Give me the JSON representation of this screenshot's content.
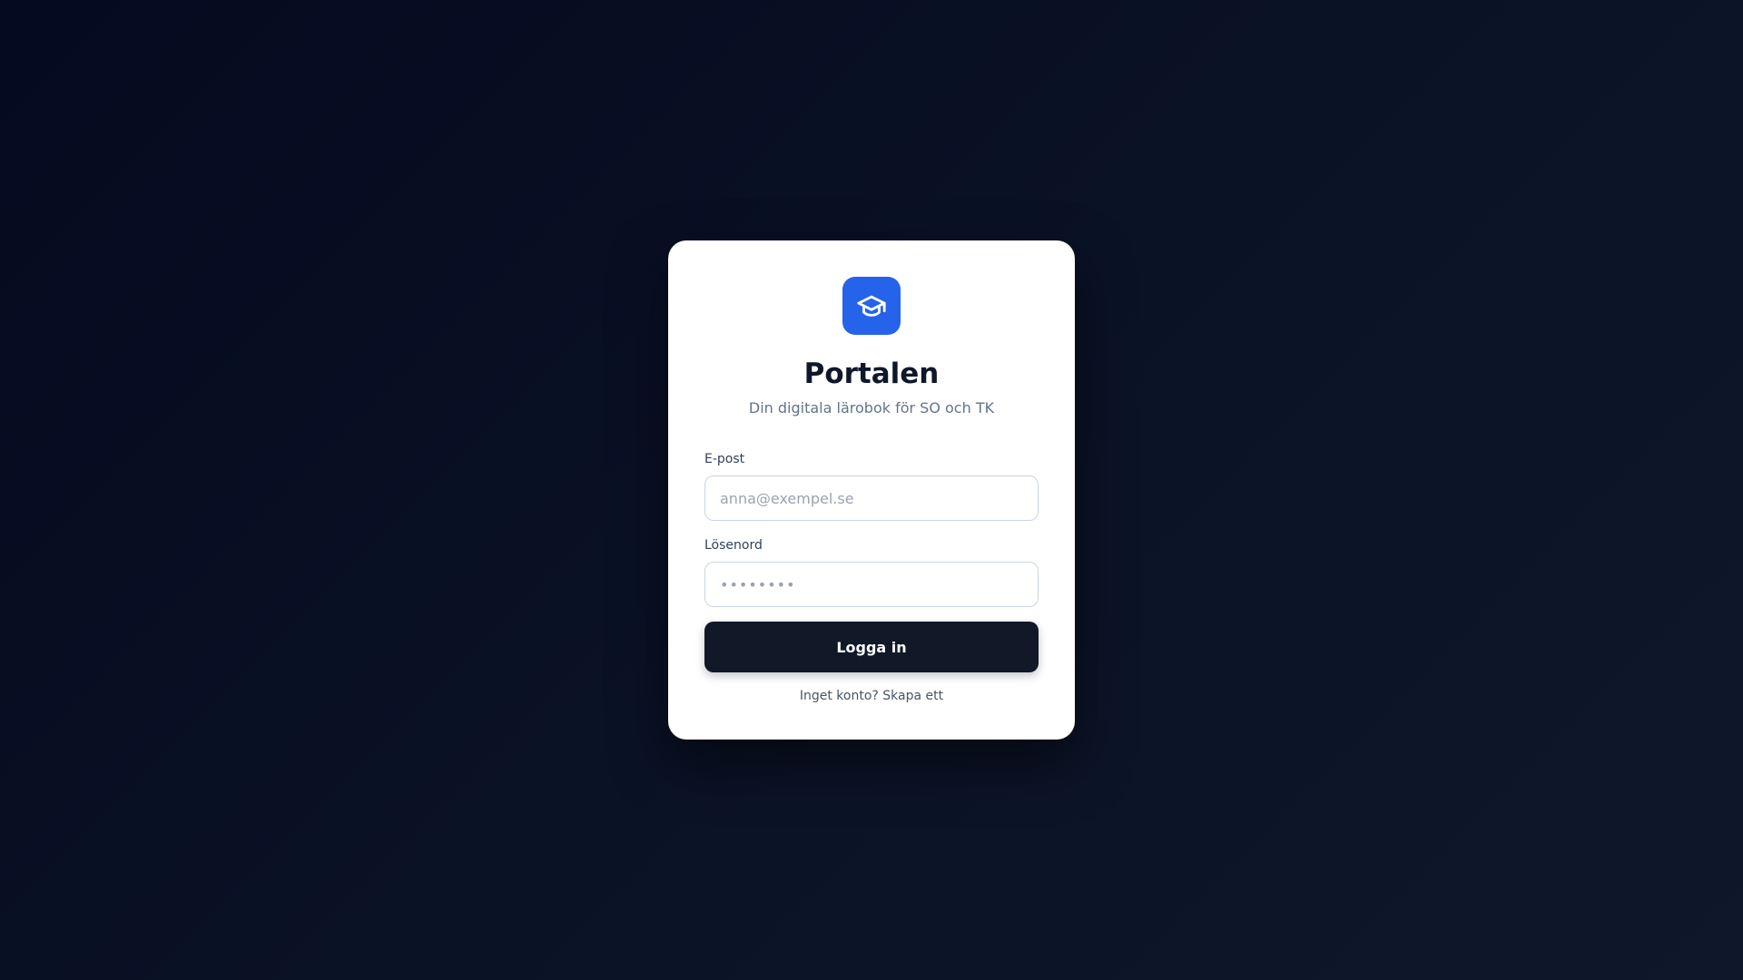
{
  "brand": {
    "title": "Portalen",
    "subtitle": "Din digitala lärobok för SO och TK",
    "logo_icon": "graduation-cap-icon",
    "accent_color": "#2563eb"
  },
  "form": {
    "email_label": "E-post",
    "email_value": "",
    "email_placeholder": "anna@exempel.se",
    "password_label": "Lösenord",
    "password_value": "",
    "password_placeholder": "••••••••",
    "submit_label": "Logga in",
    "submit_color": "#111827"
  },
  "footer": {
    "signup_prompt": "Inget konto?",
    "signup_link": "Skapa ett"
  }
}
